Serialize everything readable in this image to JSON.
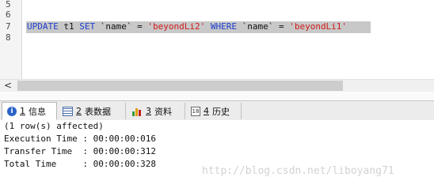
{
  "editor": {
    "line_numbers": [
      "5",
      "6",
      "7",
      "8"
    ],
    "code": {
      "kw_update": "UPDATE",
      "table": " t1 ",
      "kw_set": "SET",
      "col1": " `name` = ",
      "val1": "'beyondLi2'",
      "kw_where": " WHERE",
      "col2": " `name` = ",
      "val2": "'beyondLi1'"
    },
    "scroll_left_arrow": "<"
  },
  "tabs": [
    {
      "num": "1",
      "label": "信息",
      "icon": "info-icon",
      "active": true
    },
    {
      "num": "2",
      "label": "表数据",
      "icon": "table-data-icon",
      "active": false
    },
    {
      "num": "3",
      "label": "资料",
      "icon": "profile-icon",
      "active": false
    },
    {
      "num": "4",
      "label": "历史",
      "icon": "history-icon",
      "active": false
    }
  ],
  "output": {
    "lines": [
      "(1 row(s) affected)",
      "Execution Time : 00:00:00:016",
      "Transfer Time  : 00:00:00:312",
      "Total Time     : 00:00:00:328"
    ]
  },
  "watermark": "http://blog.csdn.net/liboyang71",
  "colors": {
    "keyword": "#1f3fd1",
    "string": "#d11a1a",
    "selection": "#c8c8c8"
  }
}
